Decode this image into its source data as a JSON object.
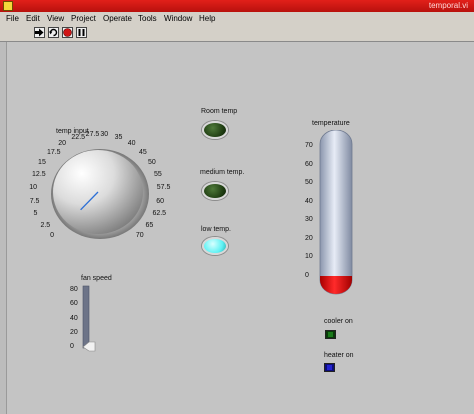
{
  "window": {
    "title": "temporal.vi"
  },
  "menu": [
    "File",
    "Edit",
    "View",
    "Project",
    "Operate",
    "Tools",
    "Window",
    "Help"
  ],
  "toolbar": {
    "run_icon": "run-arrow-icon",
    "run_continuous_icon": "run-continuously-icon",
    "abort_icon": "abort-stop-icon",
    "pause_icon": "pause-icon"
  },
  "knob": {
    "label": "temp input",
    "ticks": [
      "0",
      "2.5",
      "5",
      "7.5",
      "10",
      "12.5",
      "15",
      "17.5",
      "20",
      "22.5",
      "27.5",
      "30",
      "35",
      "40",
      "45",
      "50",
      "55",
      "57.5",
      "60",
      "62.5",
      "65",
      "70"
    ],
    "value": 0
  },
  "leds": [
    {
      "label": "Room temp",
      "color": "#1f3d12",
      "on": false
    },
    {
      "label": "medium temp.",
      "color": "#1f3d12",
      "on": false
    },
    {
      "label": "low temp.",
      "color": "#5ef2f4",
      "on": true
    }
  ],
  "thermometer": {
    "label": "temperature",
    "scale": [
      "0",
      "10",
      "20",
      "30",
      "40",
      "50",
      "60",
      "70"
    ],
    "min": 0,
    "max": 70,
    "value": 0,
    "fill_color": "#e00000"
  },
  "slider": {
    "label": "fan speed",
    "scale": [
      "0",
      "20",
      "40",
      "60",
      "80"
    ],
    "min": 0,
    "max": 80,
    "value": 0
  },
  "indicators": [
    {
      "label": "cooler on",
      "color": "#1a7a1a"
    },
    {
      "label": "heater on",
      "color": "#2323d0"
    }
  ]
}
